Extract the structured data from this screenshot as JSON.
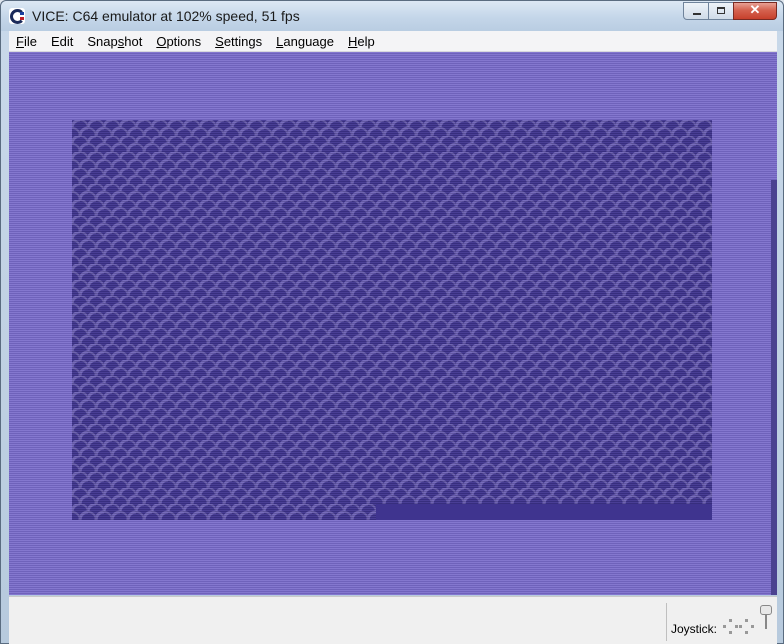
{
  "window": {
    "title": "VICE: C64 emulator at 102% speed, 51 fps",
    "controls": {
      "minimize": "minimize",
      "maximize": "maximize",
      "close": "✕"
    }
  },
  "menu": {
    "items": [
      {
        "mnemonic": "F",
        "rest": "ile"
      },
      {
        "mnemonic": "E",
        "rest": "dit",
        "mnemonic_index": 0
      },
      {
        "pre": "Snap",
        "mnemonic": "s",
        "rest": "hot"
      },
      {
        "mnemonic": "O",
        "rest": "ptions"
      },
      {
        "mnemonic": "S",
        "rest": "ettings"
      },
      {
        "mnemonic": "L",
        "rest": "anguage"
      },
      {
        "mnemonic": "H",
        "rest": "elp"
      }
    ]
  },
  "status": {
    "joystick_label": "Joystick:"
  },
  "colors": {
    "screen_border": "#7c6fc6",
    "screen_bg": "#3f348f",
    "pattern_fg": "#7064b8"
  },
  "icons": {
    "app": "commodore-logo-icon",
    "joystick": "joystick-icon"
  }
}
